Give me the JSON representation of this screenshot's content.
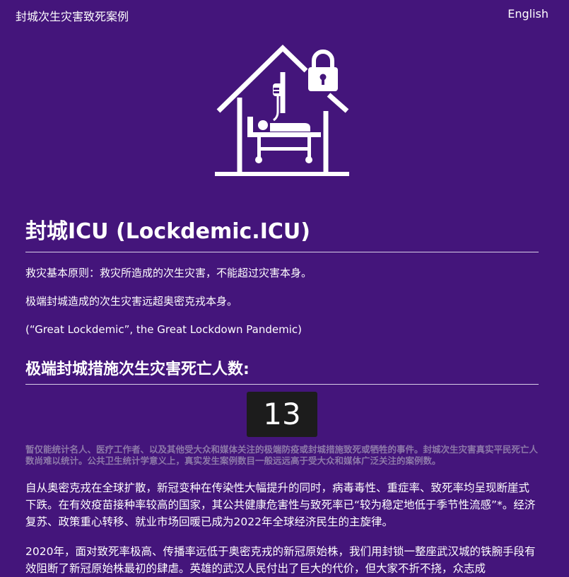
{
  "header": {
    "site_title": "封城次生灾害致死案例",
    "language_link": "English"
  },
  "hero": {
    "icon": "house-lock-icu-bed-icon",
    "color": "#ffffff"
  },
  "main": {
    "title": "封城ICU (Lockdemic.ICU)",
    "intro": [
      "救灾基本原则：救灾所造成的次生灾害，不能超过灾害本身。",
      "极端封城造成的次生灾害远超奥密克戎本身。",
      "(“Great Lockdemic”, the Great Lockdown Pandemic)"
    ],
    "death_count_heading": "极端封城措施次生灾害死亡人数:",
    "death_count": "13",
    "note": "暂仅能统计名人、医疗工作者、以及其他受大众和媒体关注的极端防疫或封城措施致死或牺牲的事件。封城次生灾害真实平民死亡人数尚难以统计。公共卫生统计学意义上，真实发生案例数目一般远远高于受大众和媒体广泛关注的案例数。",
    "paragraphs": [
      "自从奥密克戎在全球扩散，新冠变种在传染性大幅提升的同时，病毒毒性、重症率、致死率均呈现断崖式下跌。在有效疫苗接种率较高的国家，其公共健康危害性与致死率已“较为稳定地低于季节性流感”*。经济复苏、政策重心转移、就业市场回暖已成为2022年全球经济民生的主旋律。",
      "2020年，面对致死率极高、传播率远低于奥密克戎的新冠原始株，我们用封锁一整座武汉城的铁腕手段有效阻断了新冠原始株最初的肆虐。英雄的武汉人民付出了巨大的代价，但大家不折不挠，众志成"
    ]
  },
  "colors": {
    "background": "#44157b",
    "text": "#ffffff",
    "note_text": "#8d79a9",
    "counter_bg": "#1c1c1c",
    "rule": "#d9cfe8"
  }
}
